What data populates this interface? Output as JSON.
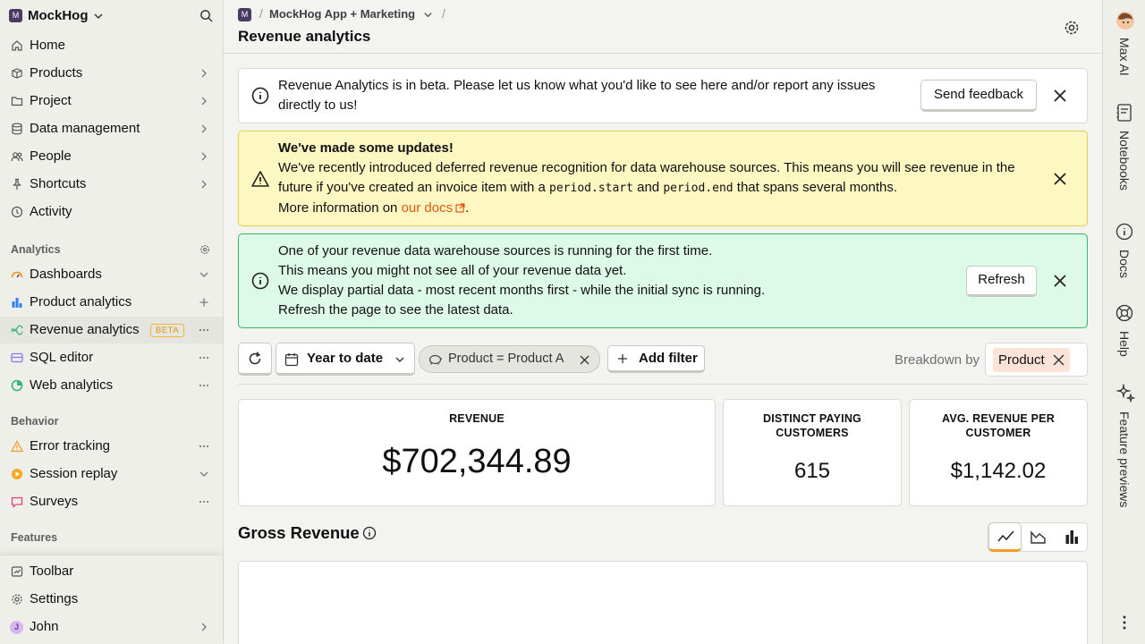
{
  "sidebar": {
    "org_initial": "M",
    "org_name": "MockHog",
    "nav": [
      {
        "label": "Home"
      },
      {
        "label": "Products"
      },
      {
        "label": "Project"
      },
      {
        "label": "Data management"
      },
      {
        "label": "People"
      },
      {
        "label": "Shortcuts"
      },
      {
        "label": "Activity"
      }
    ],
    "sections": {
      "analytics": "Analytics",
      "behavior": "Behavior",
      "features": "Features"
    },
    "analytics_items": [
      {
        "label": "Dashboards"
      },
      {
        "label": "Product analytics"
      },
      {
        "label": "Revenue analytics",
        "badge": "BETA"
      },
      {
        "label": "SQL editor"
      },
      {
        "label": "Web analytics"
      }
    ],
    "behavior_items": [
      {
        "label": "Error tracking"
      },
      {
        "label": "Session replay"
      },
      {
        "label": "Surveys"
      }
    ],
    "bottom": [
      {
        "label": "Toolbar"
      },
      {
        "label": "Settings"
      },
      {
        "label": "John",
        "initial": "J"
      }
    ]
  },
  "topbar": {
    "project_initial": "M",
    "project": "MockHog App + Marketing",
    "sep": "/",
    "title": "Revenue analytics"
  },
  "beta_notice": {
    "text": "Revenue Analytics is in beta. Please let us know what you'd like to see here and/or report any issues directly to us!",
    "button": "Send feedback"
  },
  "update_notice": {
    "title": "We've made some updates!",
    "line1_a": "We've recently introduced deferred revenue recognition for data warehouse sources. This means you will see revenue in the future if you've created an invoice item with a",
    "code1": "period.start",
    "and": "and",
    "code2": "period.end",
    "line1_b": "that spans several months.",
    "more": "More information on",
    "link": "our docs",
    "dot": "."
  },
  "sync_notice": {
    "lines": [
      "One of your revenue data warehouse sources is running for the first time.",
      "This means you might not see all of your revenue data yet.",
      "We display partial data - most recent months first - while the initial sync is running.",
      "Refresh the page to see the latest data."
    ],
    "button": "Refresh"
  },
  "filters": {
    "date_range": "Year to date",
    "product_filter": "Product = Product A",
    "add_filter": "Add filter",
    "breakdown_label": "Breakdown by",
    "breakdown_value": "Product"
  },
  "stats": [
    {
      "title": "REVENUE",
      "value": "$702,344.89"
    },
    {
      "title": "DISTINCT PAYING CUSTOMERS",
      "value": "615"
    },
    {
      "title": "AVG. REVENUE PER CUSTOMER",
      "value": "$1,142.02"
    }
  ],
  "gross": {
    "title": "Gross Revenue"
  },
  "right_panel": [
    {
      "label": "Max AI"
    },
    {
      "label": "Notebooks"
    },
    {
      "label": "Docs"
    },
    {
      "label": "Help"
    },
    {
      "label": "Feature previews"
    }
  ],
  "colors": {
    "accent": "#f39c2b",
    "link": "#e4580b",
    "warn_bg": "#fdf7c2",
    "sync_bg": "#ddf9e8"
  }
}
